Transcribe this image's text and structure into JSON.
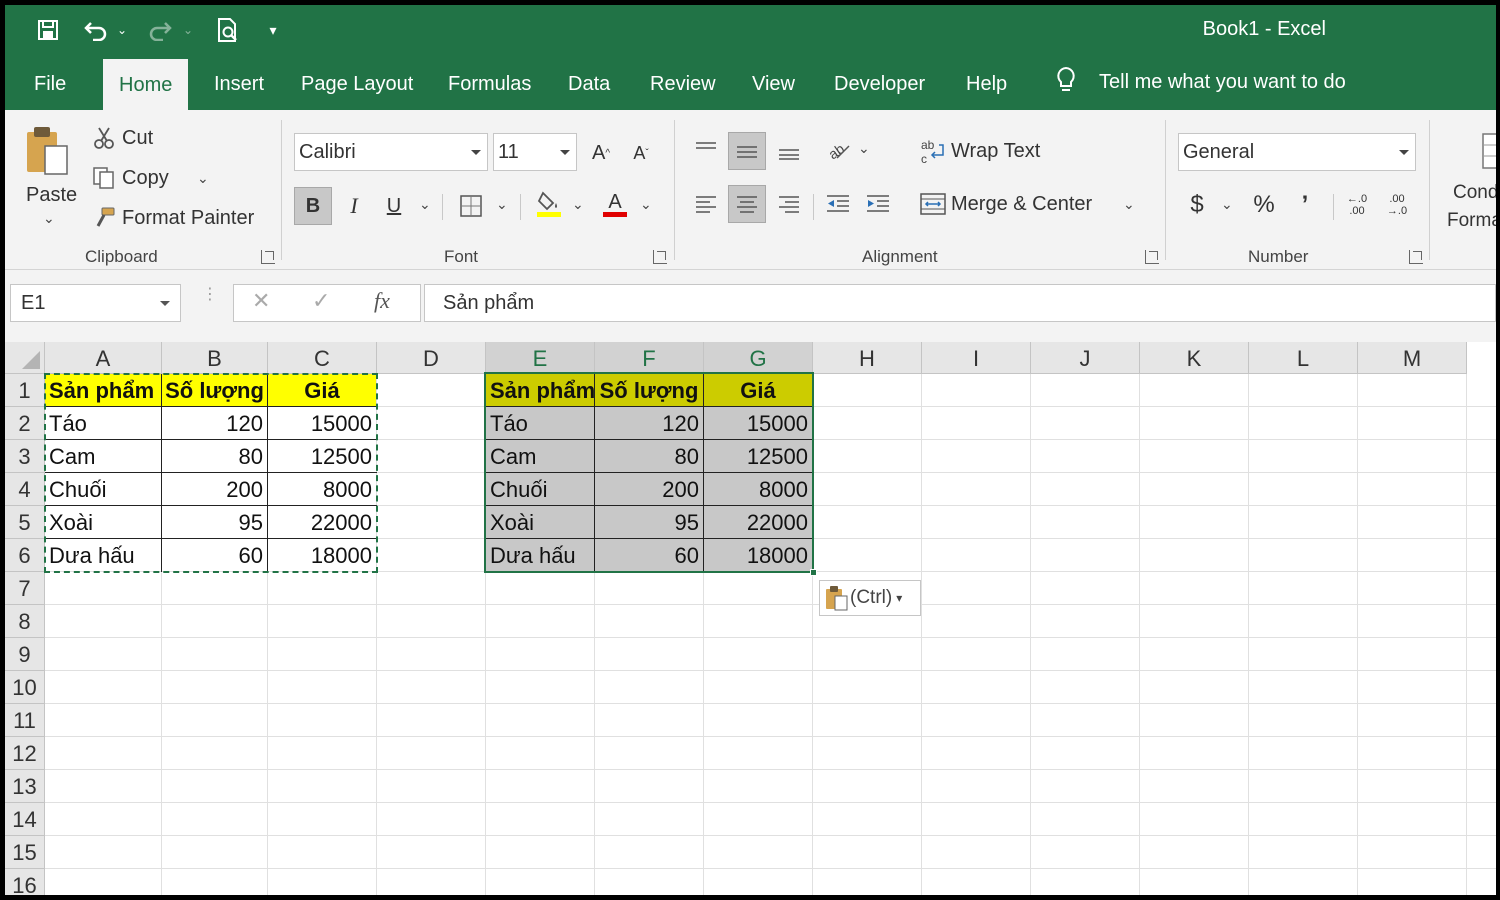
{
  "window": {
    "title": "Book1  -  Excel"
  },
  "tabs": [
    "File",
    "Home",
    "Insert",
    "Page Layout",
    "Formulas",
    "Data",
    "Review",
    "View",
    "Developer",
    "Help"
  ],
  "tell_me": "Tell me what you want to do",
  "clipboard": {
    "paste": "Paste",
    "cut": "Cut",
    "copy": "Copy",
    "format_painter": "Format Painter",
    "group": "Clipboard"
  },
  "font": {
    "name": "Calibri",
    "size": "11",
    "bold": "B",
    "italic": "I",
    "underline": "U",
    "group": "Font"
  },
  "alignment": {
    "wrap_text": "Wrap Text",
    "merge_center": "Merge & Center",
    "group": "Alignment"
  },
  "number": {
    "format": "General",
    "currency": "$",
    "percent": "%",
    "comma": "’",
    "increase_decimal_top": "←.0",
    "increase_decimal_bottom": ".00",
    "decrease_decimal_top": ".00",
    "decrease_decimal_bottom": "→.0",
    "group": "Number"
  },
  "styles": {
    "cond_line1": "Cond",
    "cond_line2": "Forma"
  },
  "formula_bar": {
    "name_box": "E1",
    "fx": "fx",
    "cancel": "✕",
    "enter": "✓",
    "content": "Sản phẩm"
  },
  "grid": {
    "columns": [
      "A",
      "B",
      "C",
      "D",
      "E",
      "F",
      "G",
      "H",
      "I",
      "J",
      "K",
      "L",
      "M"
    ],
    "rows": [
      "1",
      "2",
      "3",
      "4",
      "5",
      "6",
      "7",
      "8",
      "9",
      "10",
      "11",
      "12",
      "13",
      "14",
      "15",
      "16"
    ]
  },
  "source_table": {
    "headers": [
      "Sản phẩm",
      "Số lượng",
      "Giá"
    ],
    "rows": [
      [
        "Táo",
        "120",
        "15000"
      ],
      [
        "Cam",
        "80",
        "12500"
      ],
      [
        "Chuối",
        "200",
        "8000"
      ],
      [
        "Xoài",
        "95",
        "22000"
      ],
      [
        "Dưa hấu",
        "60",
        "18000"
      ]
    ]
  },
  "pasted_table": {
    "headers": [
      "Sản phẩm",
      "Số lượng",
      "Giá"
    ],
    "rows": [
      [
        "Táo",
        "120",
        "15000"
      ],
      [
        "Cam",
        "80",
        "12500"
      ],
      [
        "Chuối",
        "200",
        "8000"
      ],
      [
        "Xoài",
        "95",
        "22000"
      ],
      [
        "Dưa hấu",
        "60",
        "18000"
      ]
    ]
  },
  "paste_options": {
    "label": "(Ctrl)"
  },
  "colors": {
    "accent": "#217346",
    "header_fill": "#ffff00",
    "pasted_header_fill": "#cccc00",
    "pasted_body_fill": "#c8c8c8"
  }
}
